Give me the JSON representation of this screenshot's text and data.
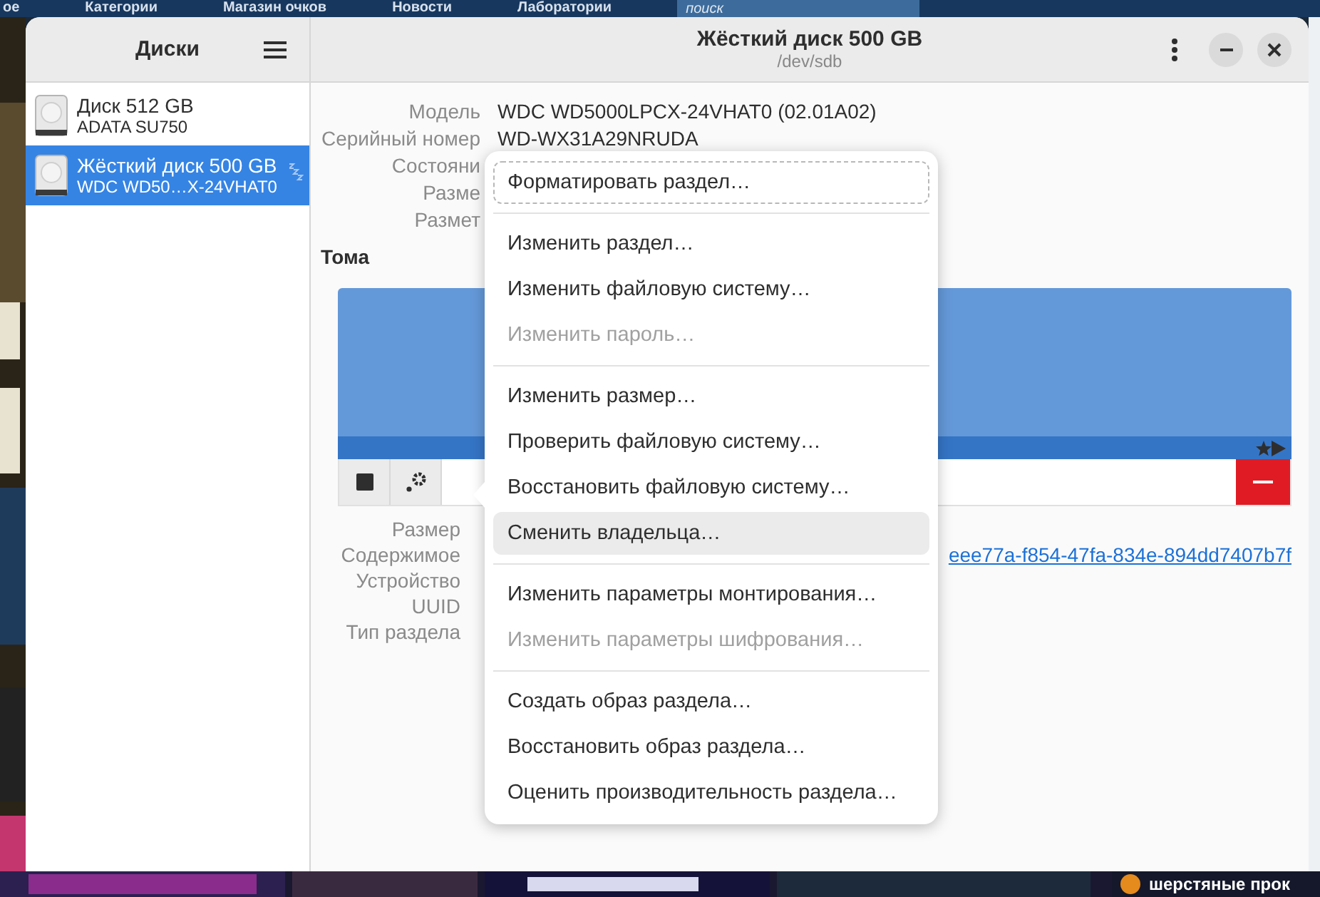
{
  "desktop": {
    "nav": [
      "ое",
      "Категории",
      "Магазин очков",
      "Новости",
      "Лаборатории"
    ],
    "search": {
      "placeholder": "поиск"
    },
    "bottom_text": "шерстяные прок"
  },
  "sidebar": {
    "title": "Диски",
    "items": [
      {
        "name": "Диск 512 GB",
        "model": "ADATA SU750",
        "selected": false,
        "standby": false
      },
      {
        "name": "Жёсткий диск 500 GB",
        "model": "WDC WD50…X-24VHAT0",
        "selected": true,
        "standby": true
      }
    ]
  },
  "header": {
    "title": "Жёсткий диск 500 GB",
    "subtitle": "/dev/sdb"
  },
  "drive_info": [
    {
      "label": "Модель",
      "value": "WDC WD5000LPCX-24VHAT0 (02.01A02)"
    },
    {
      "label": "Серийный номер",
      "value": "WD-WX31A29NRUDA"
    },
    {
      "label": "Состояни"
    },
    {
      "label": "Разме"
    },
    {
      "label": "Размет"
    }
  ],
  "volumes": {
    "title": "Тома"
  },
  "volume_info": [
    {
      "label": "Размер"
    },
    {
      "label": "Содержимое",
      "value": "eee77a-f854-47fa-834e-894dd7407b7f"
    },
    {
      "label": "Устройство"
    },
    {
      "label": "UUID"
    },
    {
      "label": "Тип раздела"
    }
  ],
  "menu": [
    {
      "kind": "item",
      "label": "Форматировать раздел…",
      "disabled": false,
      "focused": true,
      "highlighted": false
    },
    {
      "kind": "separator"
    },
    {
      "kind": "item",
      "label": "Изменить раздел…",
      "disabled": false,
      "focused": false,
      "highlighted": false
    },
    {
      "kind": "item",
      "label": "Изменить файловую систему…",
      "disabled": false,
      "focused": false,
      "highlighted": false
    },
    {
      "kind": "item",
      "label": "Изменить пароль…",
      "disabled": true,
      "focused": false,
      "highlighted": false
    },
    {
      "kind": "separator"
    },
    {
      "kind": "item",
      "label": "Изменить размер…",
      "disabled": false,
      "focused": false,
      "highlighted": false
    },
    {
      "kind": "item",
      "label": "Проверить файловую систему…",
      "disabled": false,
      "focused": false,
      "highlighted": false
    },
    {
      "kind": "item",
      "label": "Восстановить файловую систему…",
      "disabled": false,
      "focused": false,
      "highlighted": false
    },
    {
      "kind": "item",
      "label": "Сменить владельца…",
      "disabled": false,
      "focused": false,
      "highlighted": true
    },
    {
      "kind": "separator"
    },
    {
      "kind": "item",
      "label": "Изменить параметры монтирования…",
      "disabled": false,
      "focused": false,
      "highlighted": false
    },
    {
      "kind": "item",
      "label": "Изменить параметры шифрования…",
      "disabled": true,
      "focused": false,
      "highlighted": false
    },
    {
      "kind": "separator"
    },
    {
      "kind": "item",
      "label": "Создать образ раздела…",
      "disabled": false,
      "focused": false,
      "highlighted": false
    },
    {
      "kind": "item",
      "label": "Восстановить образ раздела…",
      "disabled": false,
      "focused": false,
      "highlighted": false
    },
    {
      "kind": "item",
      "label": "Оценить производительность раздела…",
      "disabled": false,
      "focused": false,
      "highlighted": false
    }
  ]
}
